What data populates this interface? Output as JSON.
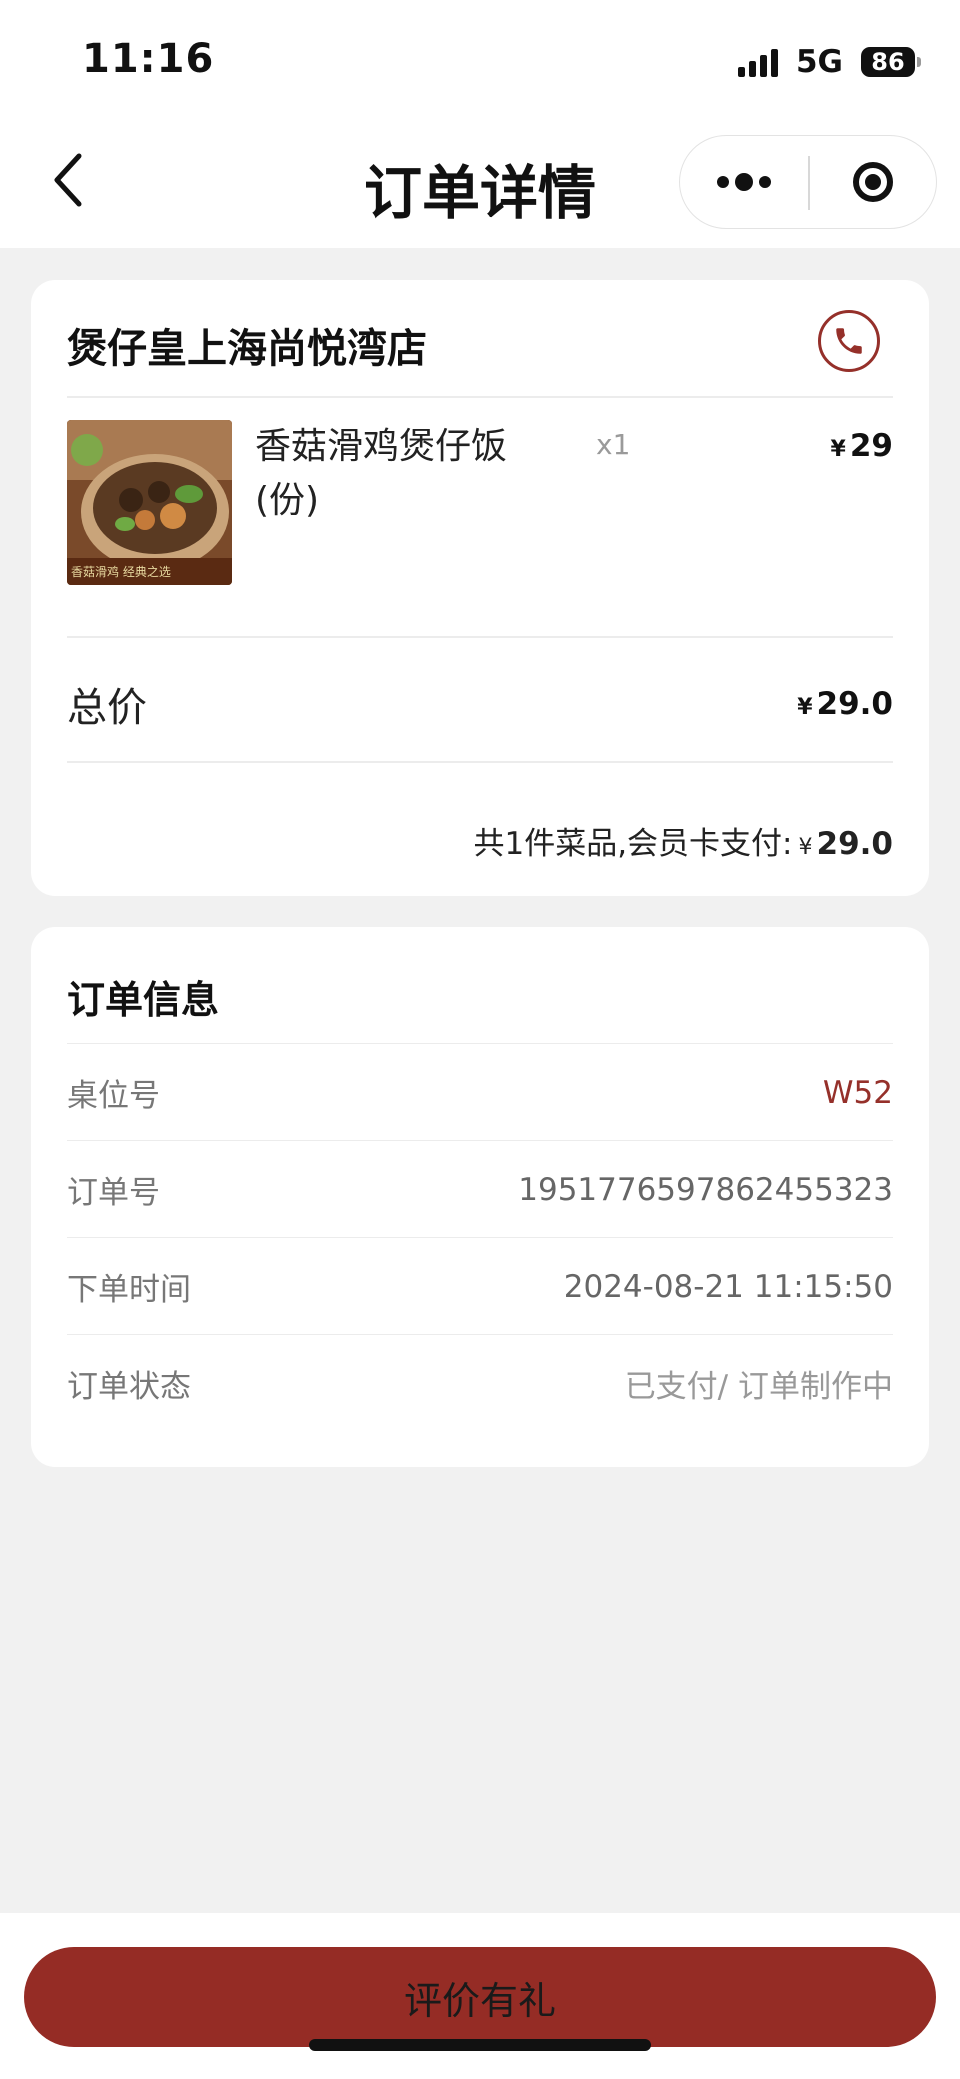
{
  "status_bar": {
    "time": "11:16",
    "network": "5G",
    "battery": "86"
  },
  "nav": {
    "title": "订单详情",
    "icons": {
      "back": "chevron-left-icon",
      "more": "more-dots-icon",
      "close": "target-circle-icon"
    }
  },
  "order": {
    "store_name": "煲仔皇上海尚悦湾店",
    "items": [
      {
        "name": "香菇滑鸡煲仔饭(份)",
        "image_caption": "香菇滑鸡 经典之选",
        "qty": "x1",
        "currency": "¥",
        "price": "29"
      }
    ],
    "total_label": "总价",
    "total_currency": "¥",
    "total_value": "29.0",
    "summary_text": "共1件菜品,会员卡支付:",
    "summary_currency": "¥",
    "summary_amount": "29.0"
  },
  "info": {
    "title": "订单信息",
    "rows": [
      {
        "label": "桌位号",
        "value": "W52"
      },
      {
        "label": "订单号",
        "value": "1951776597862455323"
      },
      {
        "label": "下单时间",
        "value": "2024-08-21 11:15:50"
      },
      {
        "label": "订单状态",
        "value": "已支付/ 订单制作中"
      }
    ]
  },
  "footer": {
    "review_button": "评价有礼"
  },
  "colors": {
    "accent": "#95302a",
    "button": "#952c25",
    "background": "#f1f1f1"
  }
}
